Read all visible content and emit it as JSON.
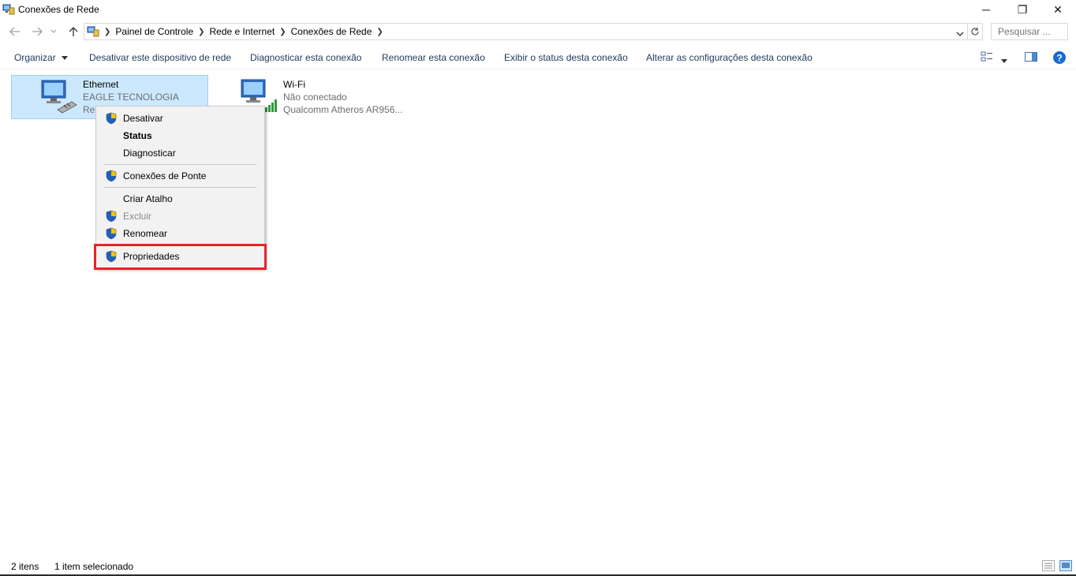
{
  "window": {
    "title": "Conexões de Rede",
    "minimize_glyph": "─",
    "maximize_glyph": "❐",
    "close_glyph": "✕"
  },
  "address": {
    "crumbs": [
      "Painel de Controle",
      "Rede e Internet",
      "Conexões de Rede"
    ],
    "search_placeholder": "Pesquisar ..."
  },
  "commands": {
    "organize": "Organizar",
    "disable": "Desativar este dispositivo de rede",
    "diagnose": "Diagnosticar esta conexão",
    "rename": "Renomear esta conexão",
    "status": "Exibir o status desta conexão",
    "change": "Alterar as configurações desta conexão"
  },
  "connections": [
    {
      "name": "Ethernet",
      "line1": "EAGLE TECNOLOGIA",
      "line2": "Rea",
      "selected": true
    },
    {
      "name": "Wi-Fi",
      "line1": "Não conectado",
      "line2": "Qualcomm Atheros AR956...",
      "selected": false
    }
  ],
  "context_menu": {
    "items": [
      {
        "label": "Desativar",
        "shield": true,
        "bold": false,
        "disabled": false
      },
      {
        "label": "Status",
        "shield": false,
        "bold": true,
        "disabled": false
      },
      {
        "label": "Diagnosticar",
        "shield": false,
        "bold": false,
        "disabled": false
      },
      {
        "label": "Conexões de Ponte",
        "shield": true,
        "bold": false,
        "disabled": false
      },
      {
        "label": "Criar Atalho",
        "shield": false,
        "bold": false,
        "disabled": false
      },
      {
        "label": "Excluir",
        "shield": true,
        "bold": false,
        "disabled": true
      },
      {
        "label": "Renomear",
        "shield": true,
        "bold": false,
        "disabled": false
      },
      {
        "label": "Propriedades",
        "shield": true,
        "bold": false,
        "disabled": false
      }
    ]
  },
  "statusbar": {
    "count": "2 itens",
    "selection": "1 item selecionado"
  },
  "colors": {
    "selection_bg": "#cce8ff",
    "highlight_border": "#e8232a",
    "command_text": "#1e395b"
  }
}
